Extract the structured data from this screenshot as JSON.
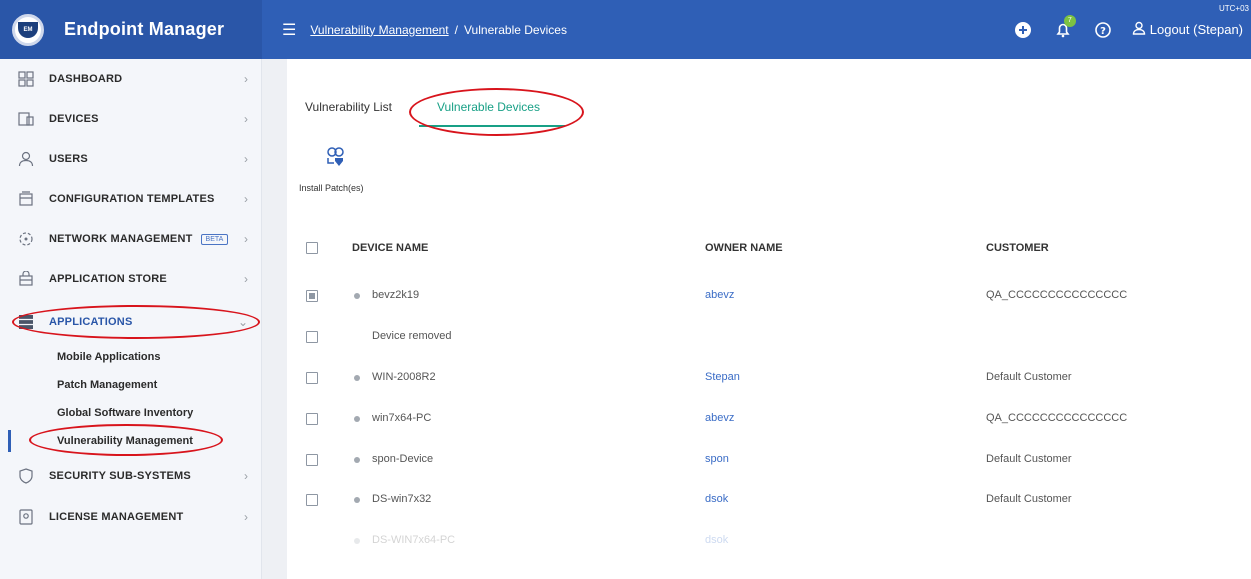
{
  "app": {
    "title": "Endpoint Manager",
    "logo_text": "EM",
    "timezone": "UTC+03",
    "accent": "#2f5fb6",
    "tab_accent": "#18a086",
    "annotation_color": "#d8141c"
  },
  "breadcrumb": {
    "parent": "Vulnerability Management",
    "separator": "/",
    "current": "Vulnerable Devices"
  },
  "topbar": {
    "logout_label": "Logout (Stepan)",
    "notification_badge": "7",
    "icons": [
      "plus-circle-icon",
      "bell-icon",
      "help-icon",
      "user-icon"
    ]
  },
  "sidebar": {
    "items": [
      {
        "label": "DASHBOARD",
        "icon": "dashboard-icon"
      },
      {
        "label": "DEVICES",
        "icon": "devices-icon"
      },
      {
        "label": "USERS",
        "icon": "users-icon"
      },
      {
        "label": "CONFIGURATION TEMPLATES",
        "icon": "templates-icon"
      },
      {
        "label": "NETWORK MANAGEMENT",
        "icon": "network-icon",
        "badge": "BETA"
      },
      {
        "label": "APPLICATION STORE",
        "icon": "store-icon"
      },
      {
        "label": "APPLICATIONS",
        "icon": "applications-icon"
      },
      {
        "label": "SECURITY SUB-SYSTEMS",
        "icon": "shield-icon"
      },
      {
        "label": "LICENSE MANAGEMENT",
        "icon": "license-icon"
      }
    ],
    "sub_items": [
      "Mobile Applications",
      "Patch Management",
      "Global Software Inventory",
      "Vulnerability Management"
    ]
  },
  "tabs": {
    "list": "Vulnerability List",
    "devices": "Vulnerable Devices"
  },
  "toolbar": {
    "install_patch_label": "Install Patch(es)"
  },
  "table": {
    "headers": {
      "device": "DEVICE NAME",
      "owner": "OWNER NAME",
      "customer": "CUSTOMER"
    },
    "rows": [
      {
        "device": "bevz2k19",
        "owner": "abevz",
        "customer": "QA_CCCCCCCCCCCCCCC"
      },
      {
        "device": "Device removed",
        "owner": "",
        "customer": ""
      },
      {
        "device": "WIN-2008R2",
        "owner": "Stepan",
        "customer": "Default Customer"
      },
      {
        "device": "win7x64-PC",
        "owner": "abevz",
        "customer": "QA_CCCCCCCCCCCCCCC"
      },
      {
        "device": "spon-Device",
        "owner": "spon",
        "customer": "Default Customer"
      },
      {
        "device": "DS-win7x32",
        "owner": "dsok",
        "customer": "Default Customer"
      },
      {
        "device": "DS-WIN7x64-PC",
        "owner": "dsok",
        "customer": ""
      }
    ]
  }
}
